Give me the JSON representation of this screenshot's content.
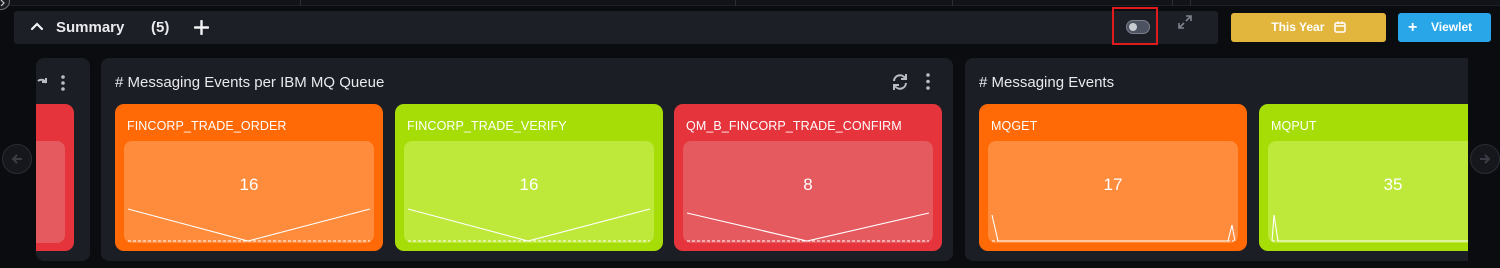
{
  "header": {
    "title": "Summary",
    "count": "(5)",
    "this_year_label": "This Year",
    "viewlet_label": "Viewlet"
  },
  "panels": [
    {
      "title": "# Messaging Events per IBM MQ Queue",
      "tiles": [
        {
          "name": "FINCORP_TRADE_ORDER",
          "value": "16",
          "color": "#ff6a06"
        },
        {
          "name": "FINCORP_TRADE_VERIFY",
          "value": "16",
          "color": "#a6dd06"
        },
        {
          "name": "QM_B_FINCORP_TRADE_CONFIRM",
          "value": "8",
          "color": "#e5343c"
        }
      ]
    },
    {
      "title": "# Messaging Events",
      "tiles": [
        {
          "name": "MQGET",
          "value": "17",
          "color": "#ff6a06"
        },
        {
          "name": "MQPUT",
          "value": "35",
          "color": "#a6dd06"
        }
      ]
    }
  ],
  "icons": {
    "collapse": "chevron-up-icon",
    "add": "plus-icon",
    "toggle": "toggle-switch-icon",
    "expand": "expand-arrows-icon",
    "calendar": "calendar-icon",
    "refresh": "refresh-icon",
    "more": "kebab-menu-icon",
    "prev": "arrow-left-icon",
    "next": "arrow-right-icon"
  },
  "colors": {
    "accent_yellow": "#e2b53c",
    "accent_blue": "#29a6e8",
    "highlight_red": "#e01b1b"
  }
}
